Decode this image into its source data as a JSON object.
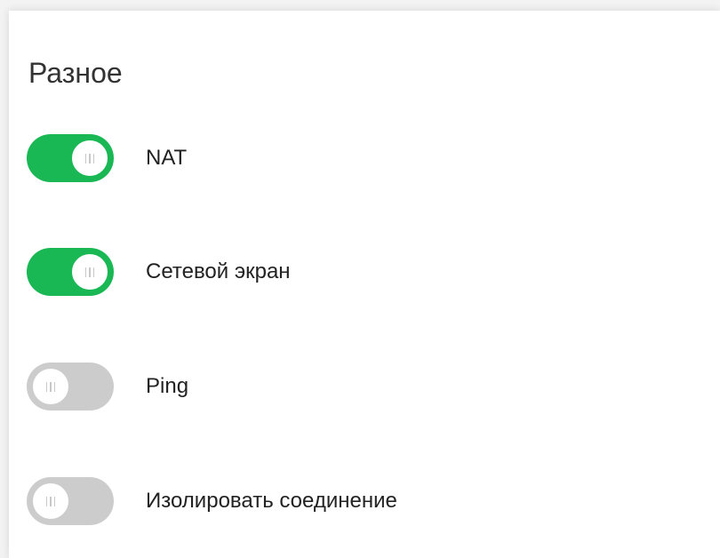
{
  "section": {
    "title": "Разное"
  },
  "colors": {
    "on": "#1ab854",
    "off": "#cccccc"
  },
  "toggles": [
    {
      "label": "NAT",
      "state": "on",
      "icon": "grip-lines-icon"
    },
    {
      "label": "Сетевой экран",
      "state": "on",
      "icon": "grip-lines-icon"
    },
    {
      "label": "Ping",
      "state": "off",
      "icon": "grip-lines-icon"
    },
    {
      "label": "Изолировать соединение",
      "state": "off",
      "icon": "grip-lines-icon"
    }
  ]
}
